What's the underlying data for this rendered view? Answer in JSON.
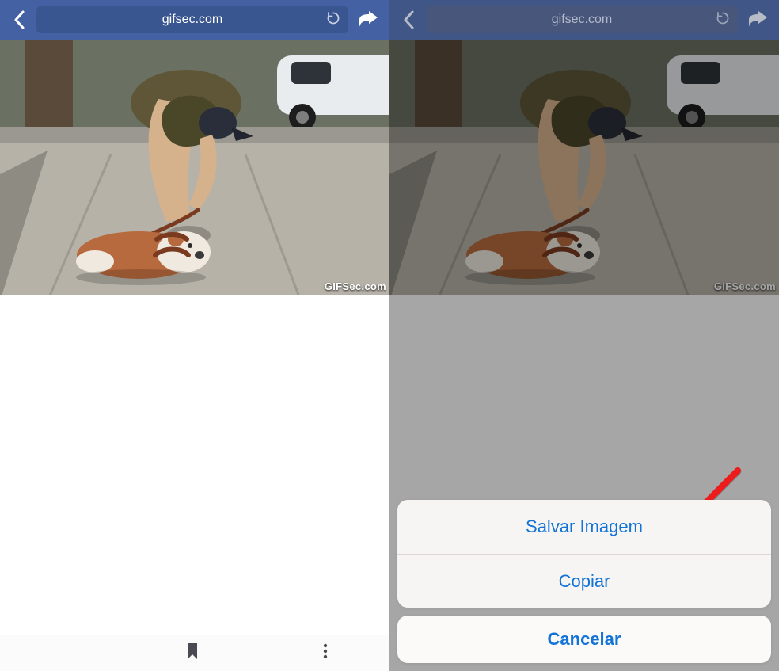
{
  "left": {
    "topbar": {
      "url": "gifsec.com"
    },
    "watermark": "GIFSec.com"
  },
  "right": {
    "topbar": {
      "url": "gifsec.com"
    },
    "watermark": "GIFSec.com",
    "actionsheet": {
      "save": "Salvar Imagem",
      "copy": "Copiar",
      "cancel": "Cancelar"
    }
  }
}
